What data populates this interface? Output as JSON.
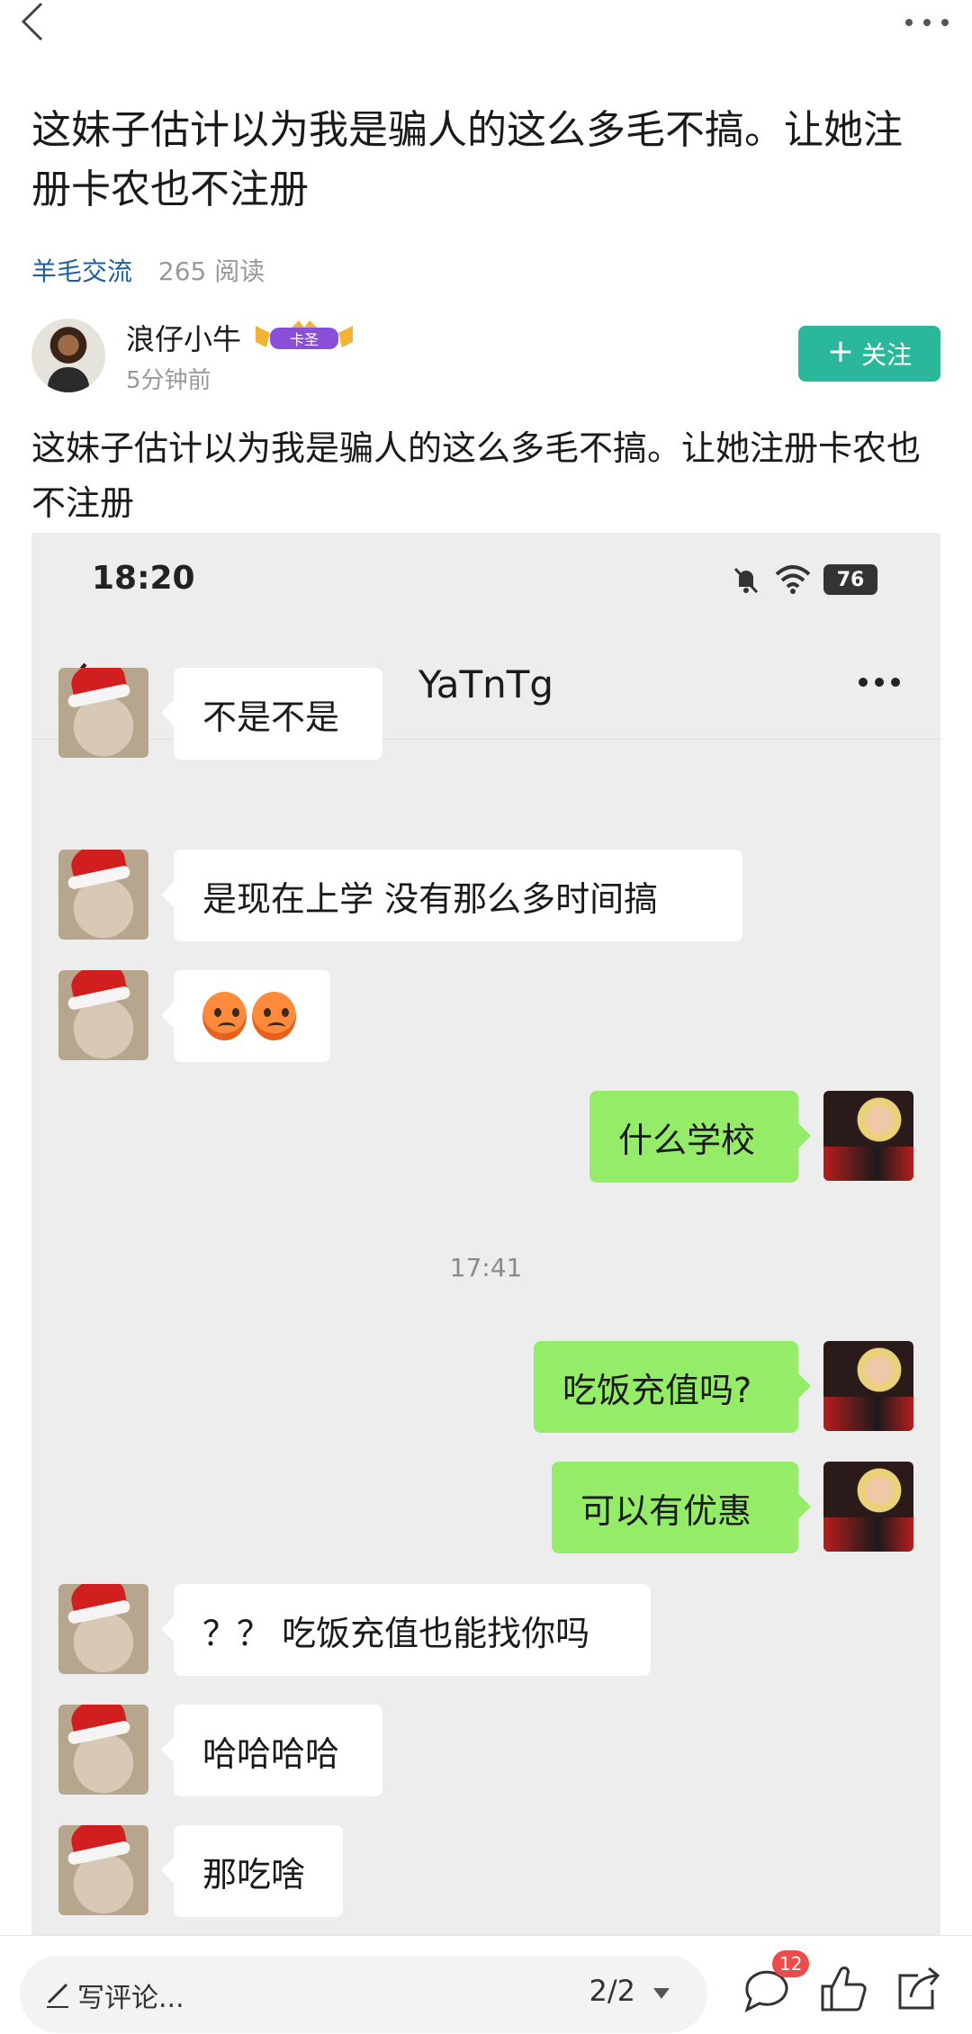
{
  "post": {
    "title": "这妹子估计以为我是骗人的这么多毛不搞。让她注册卡农也不注册",
    "category": "羊毛交流",
    "reads": "265 阅读",
    "body": "这妹子估计以为我是骗人的这么多毛不搞。让她注册卡农也不注册"
  },
  "author": {
    "name": "浪仔小牛",
    "badge": "卡圣",
    "time": "5分钟前",
    "follow_label": "关注"
  },
  "screenshot": {
    "status_time": "18:20",
    "battery": "76",
    "chat_title": "YaTnTg",
    "timestamp": "17:41",
    "messages": {
      "m1": "不是不是",
      "m2": "是现在上学 没有那么多时间搞",
      "m4": "什么学校",
      "m5": "吃饭充值吗?",
      "m6": "可以有优惠",
      "m7": "？？ 吃饭充值也能找你吗",
      "m8": "哈哈哈哈",
      "m9": "那吃啥"
    }
  },
  "bottom": {
    "comment_placeholder": "写评论...",
    "page_indicator": "2/2",
    "comment_count": "12"
  },
  "colors": {
    "accent": "#2ab79a",
    "link": "#1f5f9f",
    "bubble_mine": "#95ec69",
    "badge_red": "#f04b4b"
  },
  "icons": [
    "back-icon",
    "more-icon",
    "plus-icon",
    "mute-icon",
    "wifi-icon",
    "battery-icon",
    "pen-icon",
    "caret-down-icon",
    "comment-icon",
    "like-icon",
    "share-icon"
  ]
}
